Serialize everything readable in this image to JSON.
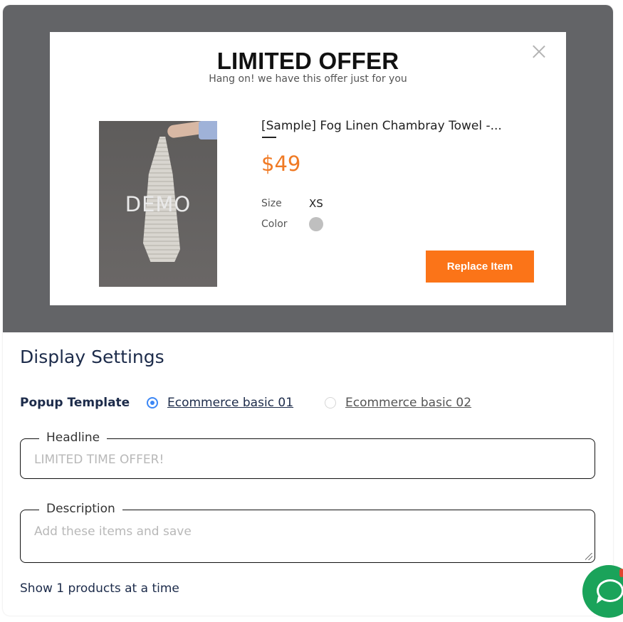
{
  "popup": {
    "title": "LIMITED OFFER",
    "subtitle": "Hang on! we have this offer just for you",
    "product": {
      "image_watermark": "DEMO",
      "name": "[Sample] Fog Linen Chambray Towel -...",
      "price": "$49",
      "size_label": "Size",
      "size_value": "XS",
      "color_label": "Color",
      "color_value": "#bfbfbf"
    },
    "replace_button": "Replace Item"
  },
  "settings": {
    "title": "Display Settings",
    "template_label": "Popup Template",
    "templates": [
      {
        "label": "Ecommerce basic 01",
        "selected": true
      },
      {
        "label": "Ecommerce basic 02",
        "selected": false
      }
    ],
    "headline": {
      "label": "Headline",
      "placeholder": "LIMITED TIME OFFER!"
    },
    "description": {
      "label": "Description",
      "placeholder": "Add these items and save"
    },
    "show_count": "Show 1 products at a time"
  },
  "colors": {
    "accent": "#fb7418",
    "price": "#f07a24",
    "preview_bg": "#636467",
    "radio_selected": "#3c87f5",
    "chat": "#1aa35a"
  },
  "icons": {
    "close": "close-icon",
    "chat": "chat-icon"
  }
}
